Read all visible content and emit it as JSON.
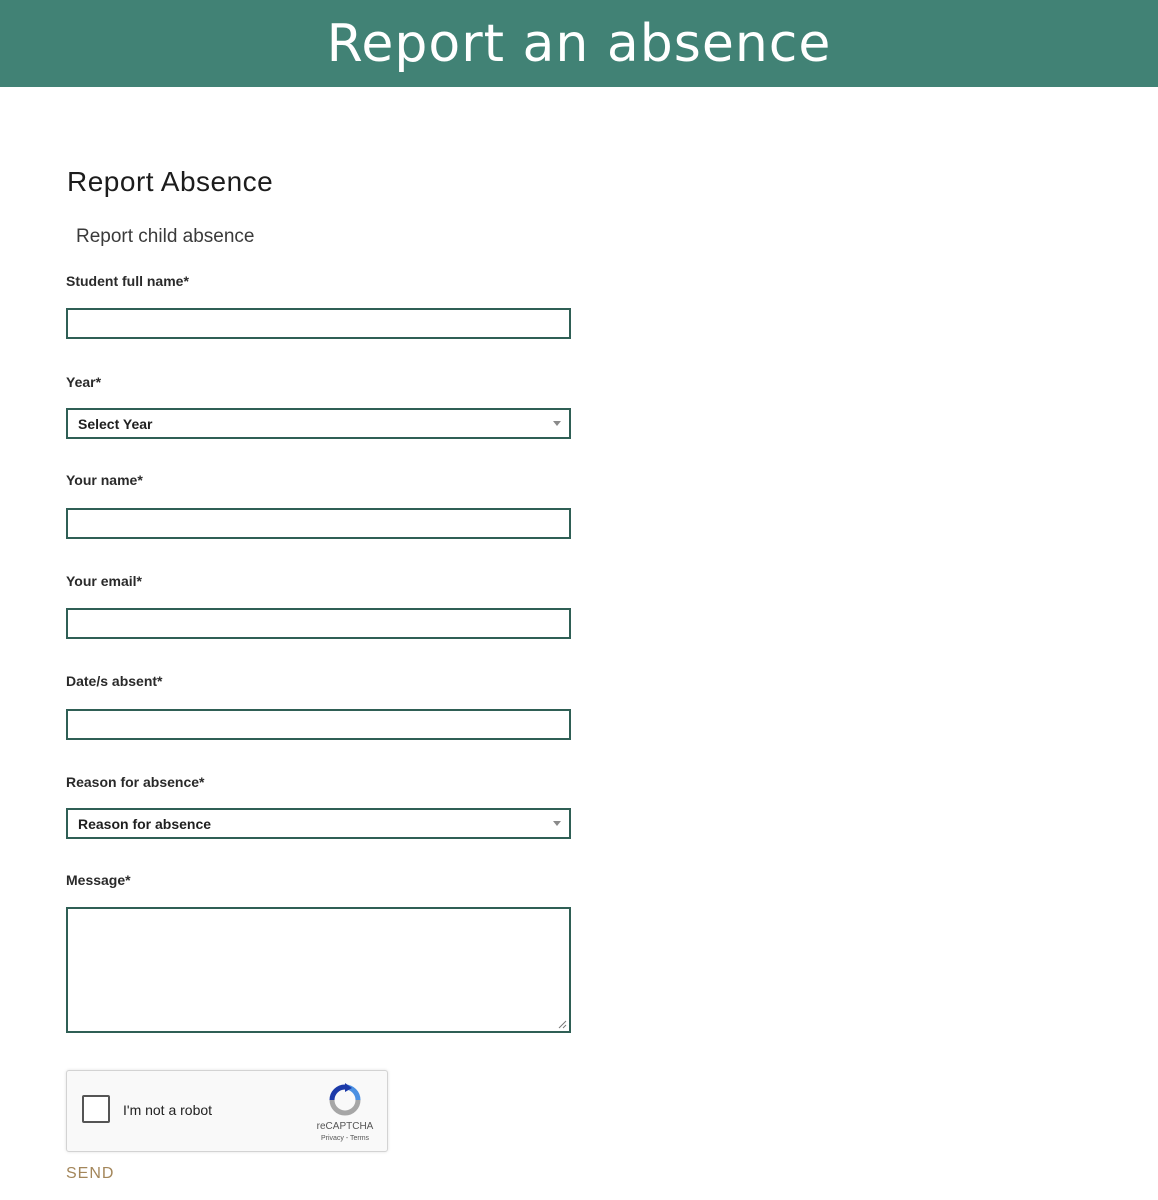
{
  "header": {
    "title": "Report an absence"
  },
  "form": {
    "title": "Report Absence",
    "subtitle": "Report child absence",
    "fields": {
      "student_name": {
        "label": "Student full name*",
        "value": ""
      },
      "year": {
        "label": "Year*",
        "selected": "Select Year"
      },
      "your_name": {
        "label": "Your name*",
        "value": ""
      },
      "your_email": {
        "label": "Your email*",
        "value": ""
      },
      "dates_absent": {
        "label": "Date/s absent*",
        "value": ""
      },
      "reason": {
        "label": "Reason for absence*",
        "selected": "Reason for absence"
      },
      "message": {
        "label": "Message*",
        "value": ""
      }
    },
    "captcha": {
      "label": "I'm not a robot",
      "brand": "reCAPTCHA",
      "links": "Privacy - Terms",
      "checked": false
    },
    "send_label": "SEND"
  },
  "colors": {
    "banner": "#418275",
    "input_border": "#2f5f55",
    "send": "#a3865a"
  }
}
